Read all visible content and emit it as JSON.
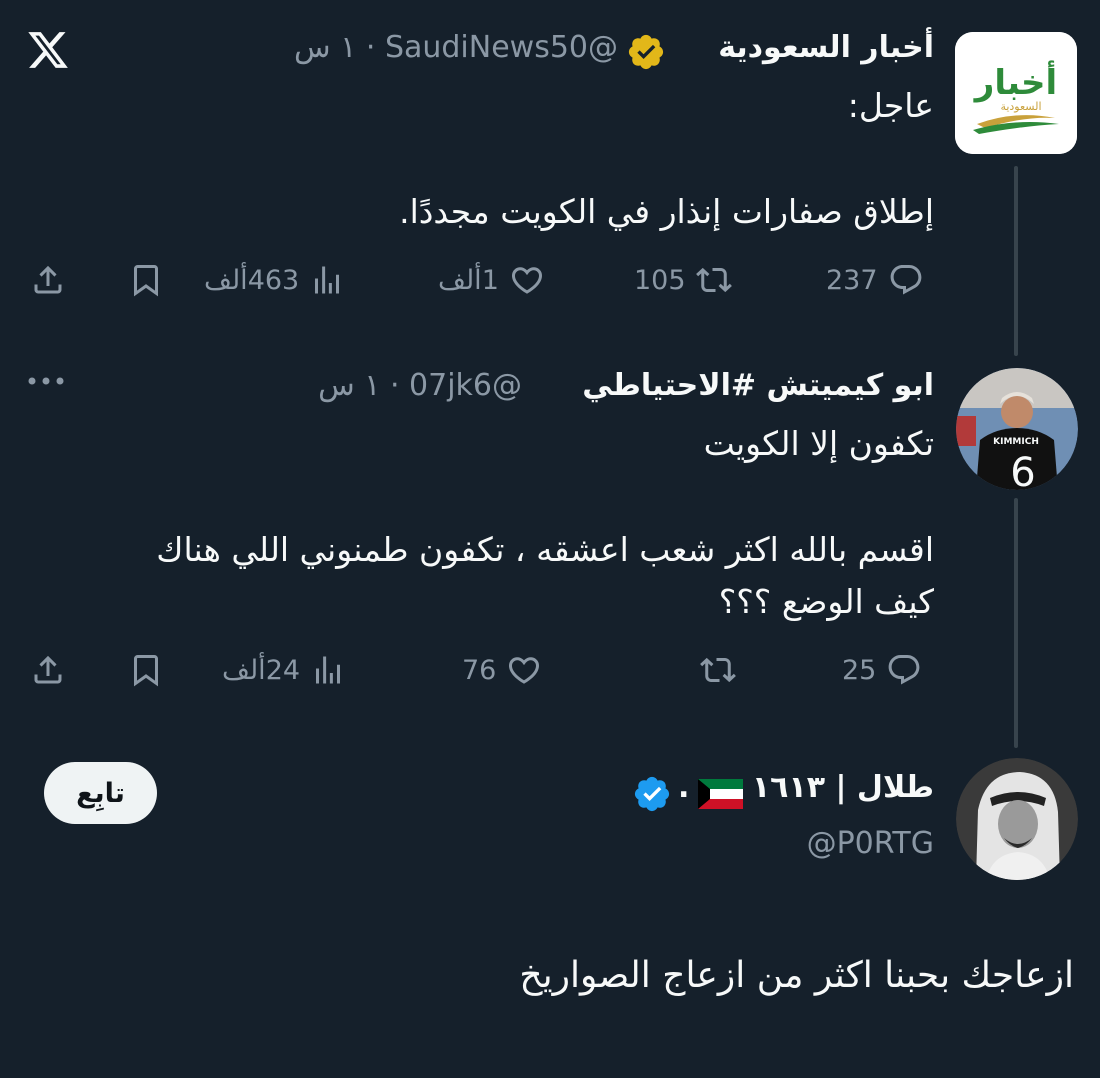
{
  "app": {
    "logo_icon": "x-logo-icon"
  },
  "tweet1": {
    "display_name": "أخبار السعودية",
    "verified": "gold",
    "meta": "@SaudiNews50 · ١ س",
    "lines": [
      "عاجل:",
      "إطلاق صفارات إنذار في الكويت مجددًا."
    ],
    "avatar_text": "أخبار",
    "avatar_subtext": "السعودية",
    "actions": {
      "replies": "237",
      "retweets": "105",
      "likes": "1ألف",
      "views": "463ألف"
    }
  },
  "tweet2": {
    "display_name": "ابو كيميتش #الاحتياطي",
    "meta": "@07jk6 · ١ س",
    "lines": [
      "تكفون إلا الكويت",
      "اقسم بالله اكثر شعب اعشقه ، تكفون طمنوني اللي هناك",
      "كيف الوضع ؟؟؟"
    ],
    "avatar_jersey_name": "KIMMICH",
    "avatar_jersey_number": "6",
    "actions": {
      "replies": "25",
      "retweets": "",
      "likes": "76",
      "views": "24ألف"
    }
  },
  "tweet3": {
    "display_name": "طلال | ١٦١٣",
    "name_suffix": ".",
    "verified": "blue",
    "handle": "@P0RTG",
    "follow_label": "تابِع",
    "text": "ازعاجك بحبنا اكثر من ازعاج الصواريخ"
  },
  "colors": {
    "background": "#15202b",
    "text_primary": "#f7f9f9",
    "text_secondary": "#8b98a5",
    "thread_line": "#38444d",
    "verified_gold": "#e2b719",
    "verified_blue": "#1d9bf0",
    "kuwait_green": "#007a3d",
    "kuwait_red": "#ce1126"
  }
}
